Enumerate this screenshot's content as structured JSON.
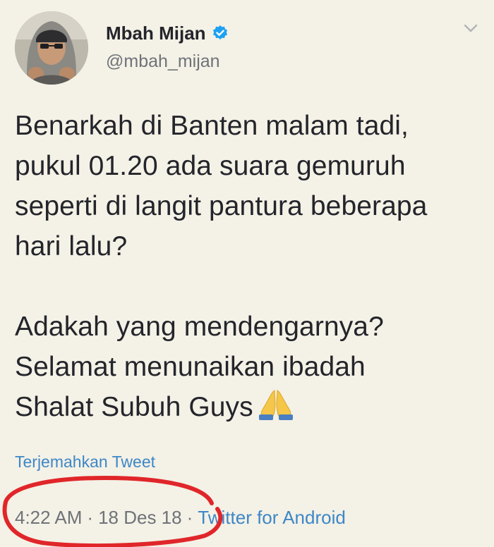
{
  "author": {
    "display_name": "Mbah Mijan",
    "handle": "@mbah_mijan",
    "verified_icon": "verified-badge-icon",
    "avatar_icon": "user-avatar"
  },
  "menu": {
    "icon": "chevron-down-icon"
  },
  "tweet": {
    "paragraph1": "Benarkah di Banten malam tadi,\npukul 01.20 ada suara gemuruh\nseperti di langit pantura beberapa\nhari lalu?",
    "paragraph2": "Adakah yang mendengarnya?\nSelamat menunaikan ibadah\nShalat Subuh Guys",
    "emoji": "folded-hands-icon"
  },
  "translate_label": "Terjemahkan Tweet",
  "meta": {
    "time": "4:22 AM",
    "date": "18 Des 18",
    "separator": "·",
    "source": "Twitter for Android"
  },
  "colors": {
    "background": "#f4f1e6",
    "text": "#24252b",
    "secondary": "#6f7378",
    "link": "#3d87c7",
    "verified": "#1da1f2",
    "annotation_red": "#e0262a"
  }
}
